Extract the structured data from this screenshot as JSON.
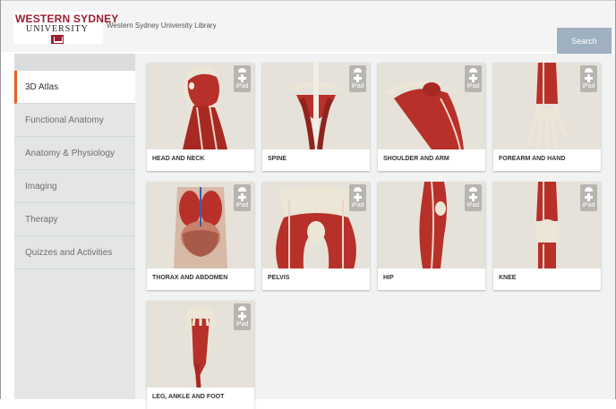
{
  "header": {
    "logo_line1": "WESTERN SYDNEY",
    "logo_line2": "UNIVERSITY",
    "site_title": "Western Sydney University Library",
    "search_label": "Search"
  },
  "sidebar": {
    "items": [
      {
        "label": "3D Atlas",
        "active": true
      },
      {
        "label": "Functional Anatomy",
        "active": false
      },
      {
        "label": "Anatomy & Physiology",
        "active": false
      },
      {
        "label": "Imaging",
        "active": false
      },
      {
        "label": "Therapy",
        "active": false
      },
      {
        "label": "Quizzes and Activities",
        "active": false
      }
    ]
  },
  "cards": [
    {
      "title": "HEAD AND NECK",
      "platform": "iPad",
      "icon": "android-icon"
    },
    {
      "title": "SPINE",
      "platform": "iPad",
      "icon": "android-icon"
    },
    {
      "title": "SHOULDER AND ARM",
      "platform": "iPad",
      "icon": "android-icon"
    },
    {
      "title": "FOREARM AND HAND",
      "platform": "iPad",
      "icon": "android-icon"
    },
    {
      "title": "THORAX AND ABDOMEN",
      "platform": "iPad",
      "icon": "android-icon"
    },
    {
      "title": "PELVIS",
      "platform": "iPad",
      "icon": "android-icon"
    },
    {
      "title": "HIP",
      "platform": "iPad",
      "icon": "android-icon"
    },
    {
      "title": "KNEE",
      "platform": "iPad",
      "icon": "android-icon"
    },
    {
      "title": "LEG, ANKLE AND FOOT",
      "platform": "iPad",
      "icon": "android-icon"
    }
  ],
  "colors": {
    "brand": "#9a1e32",
    "active_accent": "#e45f1c",
    "search_button": "#9fb0c0",
    "muscle": "#b8302a",
    "bone": "#ece6d6"
  }
}
